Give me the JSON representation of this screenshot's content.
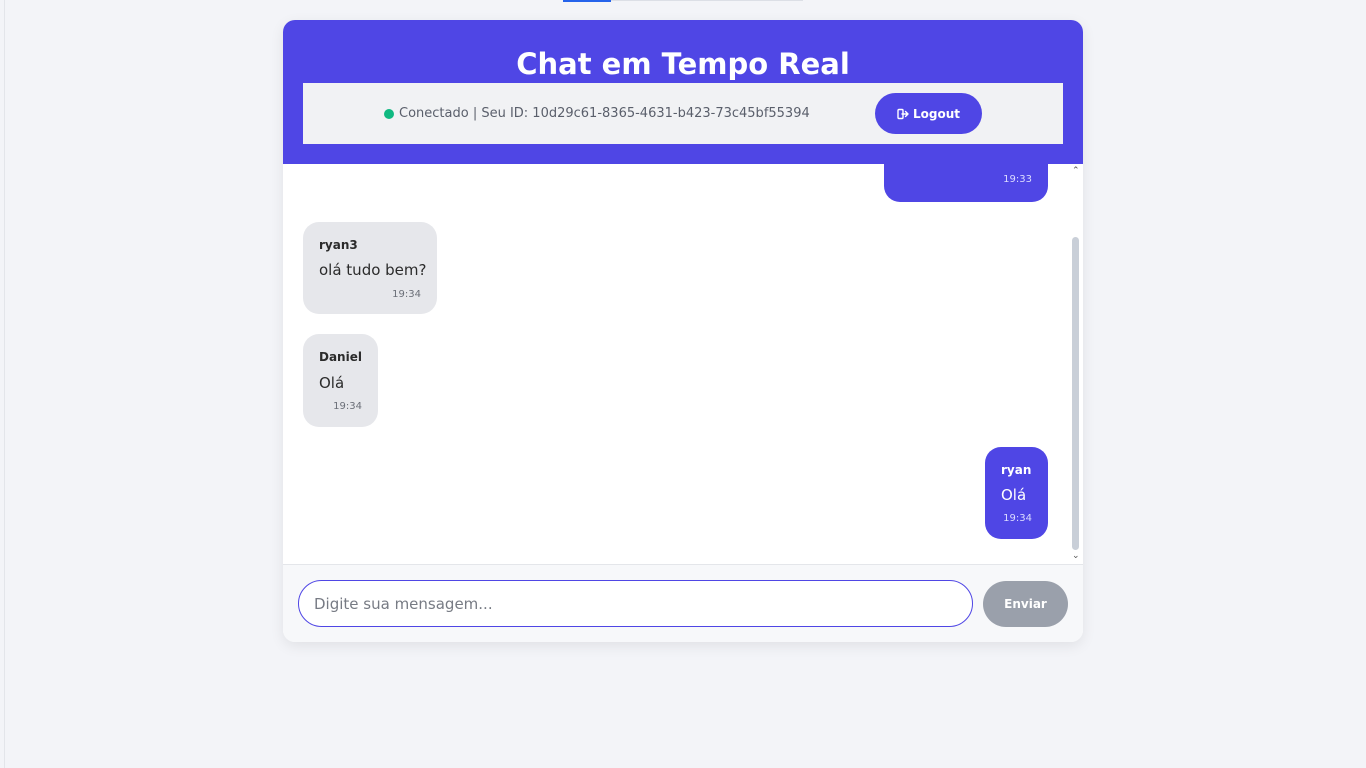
{
  "header": {
    "title": "Chat em Tempo Real",
    "status_text": "Conectado | Seu ID: 10d29c61-8365-4631-b423-73c45bf55394",
    "status_color": "#10b981",
    "logout_label": "Logout",
    "logout_icon": "sign-out-icon"
  },
  "messages": [
    {
      "user": "",
      "text": "",
      "time": "19:33",
      "direction": "outgoing"
    },
    {
      "user": "ryan3",
      "text": "olá tudo bem?",
      "time": "19:34",
      "direction": "incoming"
    },
    {
      "user": "Daniel",
      "text": "Olá",
      "time": "19:34",
      "direction": "incoming"
    },
    {
      "user": "ryan",
      "text": "Olá",
      "time": "19:34",
      "direction": "outgoing"
    }
  ],
  "composer": {
    "placeholder": "Digite sua mensagem...",
    "value": "",
    "send_label": "Enviar"
  },
  "colors": {
    "accent": "#4f46e5",
    "incoming_bubble": "#e6e7eb",
    "send_disabled": "#9aa0ab"
  }
}
